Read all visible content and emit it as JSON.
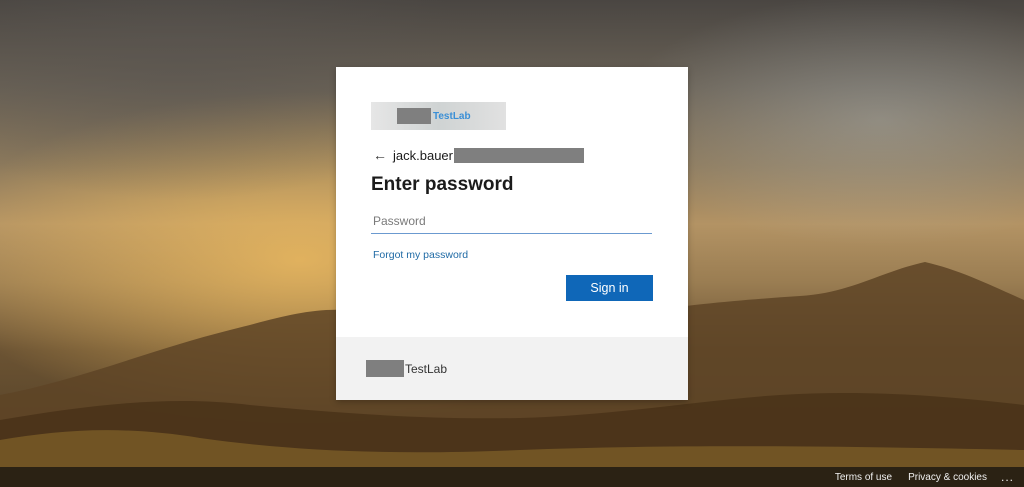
{
  "background": {
    "sky_color": "#4a4642",
    "glow_color": "#e8b45c"
  },
  "signin_card": {
    "logo_text": "TestLab",
    "back_icon": "back-arrow-icon",
    "back_glyph": "←",
    "username_prefix": "jack.bauer",
    "title": "Enter password",
    "password_placeholder": "Password",
    "password_value": "",
    "forgot_link": "Forgot my password",
    "signin_label": "Sign in",
    "accent_color": "#0f67b8"
  },
  "card_footer": {
    "org_text": "TestLab"
  },
  "page_footer": {
    "terms": "Terms of use",
    "privacy": "Privacy & cookies",
    "more": "..."
  }
}
